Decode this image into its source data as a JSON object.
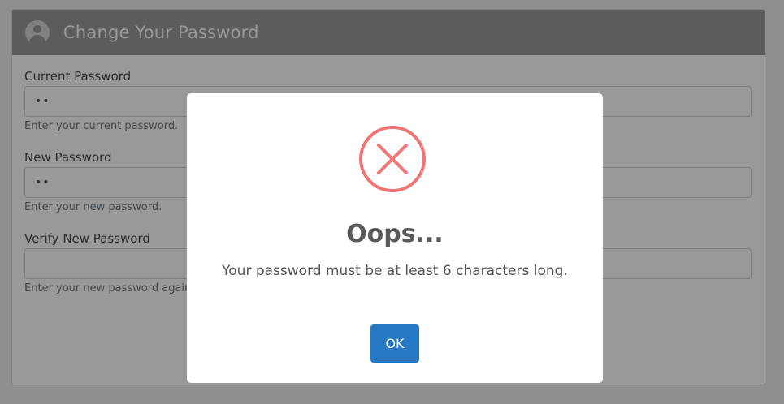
{
  "header": {
    "title": "Change Your Password",
    "icon": "user-avatar-icon"
  },
  "form": {
    "current": {
      "label": "Current Password",
      "value": "••",
      "hint": "Enter your current password."
    },
    "new": {
      "label": "New Password",
      "value": "••",
      "hint": "Enter your new password."
    },
    "verify": {
      "label": "Verify New Password",
      "value": "",
      "hint": "Enter your new password again."
    }
  },
  "dialog": {
    "icon": "error-x-icon",
    "title": "Oops...",
    "message": "Your password must be at least 6 characters long.",
    "ok_label": "OK"
  },
  "colors": {
    "header_bg": "#9a9a9a",
    "error": "#f27474",
    "primary_button": "#2778c4"
  }
}
